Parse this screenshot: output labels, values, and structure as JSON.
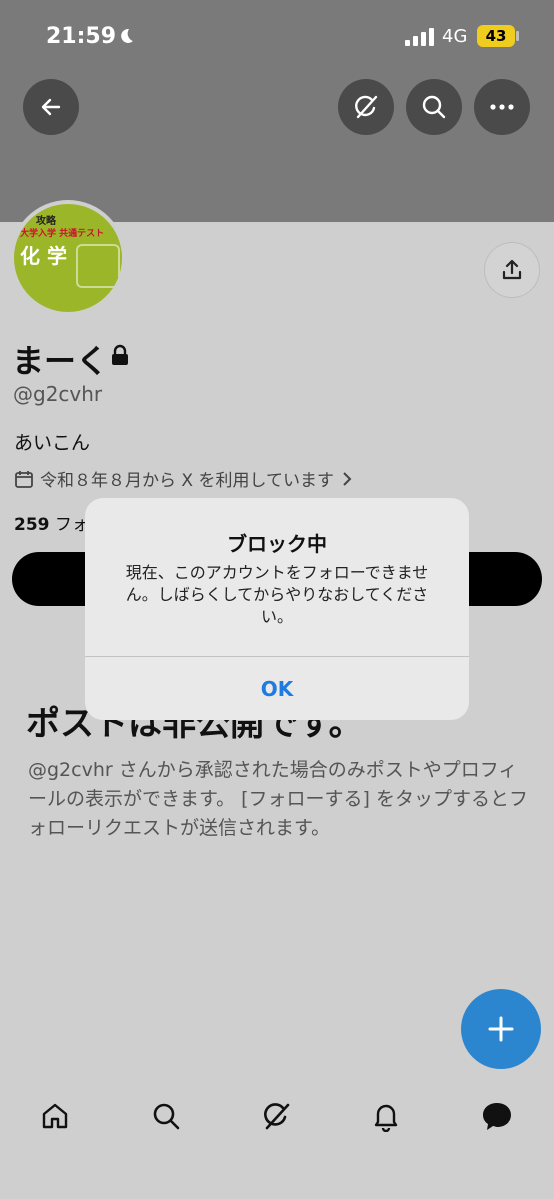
{
  "status_bar": {
    "time": "21:59",
    "network": "4G",
    "battery": "43"
  },
  "profile": {
    "avatar_text": {
      "line1": "攻略",
      "line2": "大学入学 共通テスト",
      "line3": "化 学"
    },
    "name": "まーく",
    "handle": "@g2cvhr",
    "bio": "あいこん",
    "joined": "令和８年８月から X を利用しています",
    "following_count": "259",
    "following_label": "フォ"
  },
  "private_notice": {
    "title": "ポストは非公開です。",
    "description": "@g2cvhr さんから承認された場合のみポストやプロフィールの表示ができます。 [フォローする] をタップするとフォローリクエストが送信されます。"
  },
  "dialog": {
    "title": "ブロック中",
    "message": "現在、このアカウントをフォローできません。しばらくしてからやりなおしてください。",
    "ok_label": "OK"
  },
  "fab": {
    "icon": "plus-icon"
  },
  "colors": {
    "accent": "#1f7be0",
    "fab": "#2b86cf",
    "battery": "#f0cc1e"
  }
}
